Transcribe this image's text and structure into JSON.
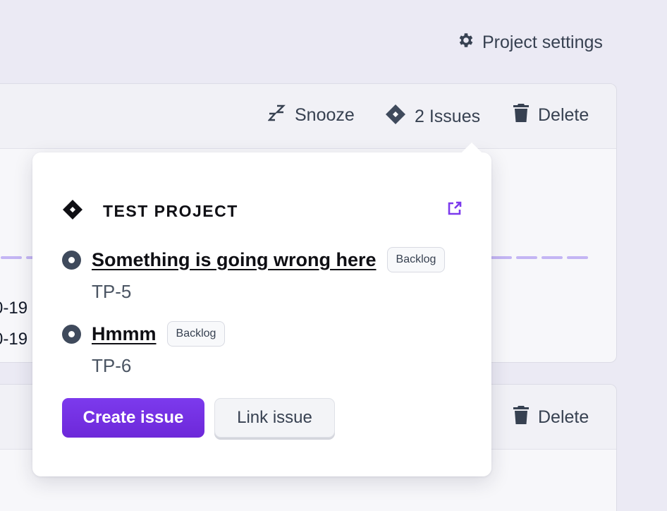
{
  "header": {
    "settings_label": "Project settings"
  },
  "card1": {
    "snooze_label": "Snooze",
    "issues_label": "2 Issues",
    "delete_label": "Delete",
    "date_fragments": [
      "0-19",
      "0-19"
    ]
  },
  "card2": {
    "delete_label": "Delete"
  },
  "popover": {
    "project_name": "TEST PROJECT",
    "issues": [
      {
        "title": "Something is going wrong here",
        "status": "Backlog",
        "key": "TP-5"
      },
      {
        "title": "Hmmm",
        "status": "Backlog",
        "key": "TP-6"
      }
    ],
    "create_label": "Create issue",
    "link_label": "Link issue"
  },
  "colors": {
    "accent": "#6d28d9",
    "link_icon": "#7c3aed"
  }
}
